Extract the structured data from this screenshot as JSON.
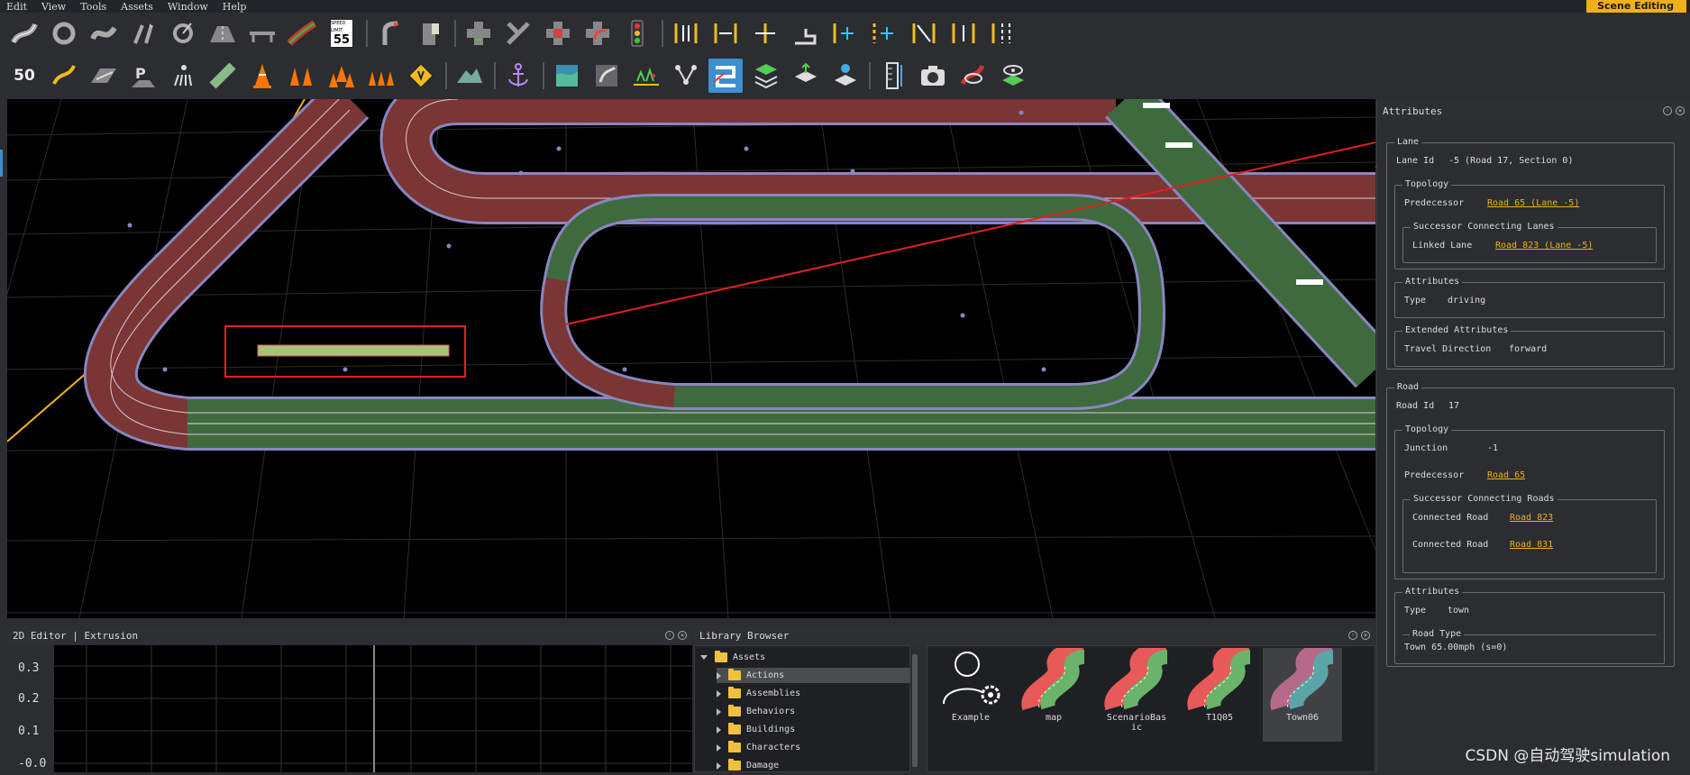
{
  "menubar": {
    "items": [
      "Edit",
      "View",
      "Tools",
      "Assets",
      "Window",
      "Help"
    ],
    "mode": "Scene Editing"
  },
  "toolbar": {
    "speed_sign_top": "SPEED LIMIT",
    "speed_sign_value": "55",
    "speed_badge": "50"
  },
  "attributes_panel": {
    "title": "Attributes",
    "lane": {
      "title": "Lane",
      "lane_id_label": "Lane Id",
      "lane_id_value": "-5 (Road 17, Section 0)",
      "topology": {
        "title": "Topology",
        "predecessor_label": "Predecessor",
        "predecessor_value": "Road 65 (Lane -5)",
        "successor_title": "Successor Connecting Lanes",
        "linked_lane_label": "Linked Lane",
        "linked_lane_value": "Road 823 (Lane -5)"
      },
      "attributes": {
        "title": "Attributes",
        "type_label": "Type",
        "type_value": "driving"
      },
      "extended": {
        "title": "Extended Attributes",
        "travel_label": "Travel Direction",
        "travel_value": "forward"
      }
    },
    "road": {
      "title": "Road",
      "road_id_label": "Road Id",
      "road_id_value": "17",
      "topology": {
        "title": "Topology",
        "junction_label": "Junction",
        "junction_value": "-1",
        "predecessor_label": "Predecessor",
        "predecessor_value": "Road 65",
        "successor_title": "Successor Connecting Roads",
        "connected_label_1": "Connected Road",
        "connected_value_1": "Road 823",
        "connected_label_2": "Connected Road",
        "connected_value_2": "Road 831"
      },
      "attributes": {
        "title": "Attributes",
        "type_label": "Type",
        "type_value": "town",
        "road_type_title": "Road Type",
        "road_type_value": "Town 65.00mph (s=0)"
      }
    }
  },
  "editor_2d": {
    "title": "2D Editor | Extrusion",
    "y_labels": [
      "0.3",
      "0.2",
      "0.1",
      "-0.0"
    ]
  },
  "library": {
    "title": "Library Browser",
    "tree": [
      "Assets",
      "Actions",
      "Assemblies",
      "Behaviors",
      "Buildings",
      "Characters",
      "Damage"
    ],
    "assets": [
      "Example",
      "map",
      "ScenarioBasic",
      "T1Q05",
      "Town06"
    ]
  },
  "colors": {
    "accent": "#f0b01a",
    "selection": "#3d8fd0",
    "arrow": "#e02020"
  },
  "watermark": "CSDN @自动驾驶simulation"
}
